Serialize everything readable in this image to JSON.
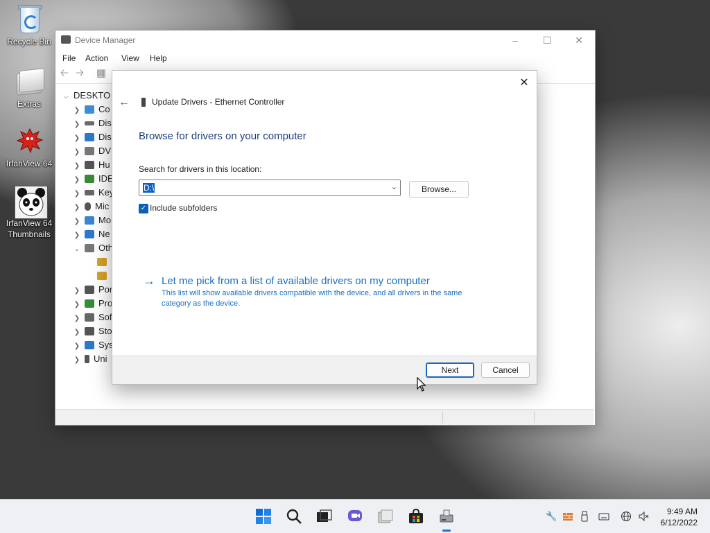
{
  "desktop": {
    "icons": [
      {
        "label": "Recycle Bin"
      },
      {
        "label": "Extras"
      },
      {
        "label": "IrfanView 64"
      },
      {
        "label": "IrfanView 64 Thumbnails"
      }
    ]
  },
  "device_manager": {
    "title": "Device Manager",
    "menu": [
      "File",
      "Action",
      "View",
      "Help"
    ],
    "tree": {
      "root": "DESKTO",
      "items": [
        {
          "label": "Co",
          "color": "#3c8fd6"
        },
        {
          "label": "Dis",
          "color": "#6b6b6b"
        },
        {
          "label": "Dis",
          "color": "#2f77c9"
        },
        {
          "label": "DV",
          "color": "#777777"
        },
        {
          "label": "Hu",
          "color": "#555555"
        },
        {
          "label": "IDE",
          "color": "#3a8a3a"
        },
        {
          "label": "Key",
          "color": "#666666"
        },
        {
          "label": "Mic",
          "color": "#555555"
        },
        {
          "label": "Mo",
          "color": "#3b86d1"
        },
        {
          "label": "Ne",
          "color": "#2f77c9"
        },
        {
          "label": "Oth",
          "color": "#777777"
        },
        {
          "label": "",
          "color": "#d8a227"
        },
        {
          "label": "",
          "color": "#d8a227"
        },
        {
          "label": "Por",
          "color": "#555555"
        },
        {
          "label": "Pro",
          "color": "#3a8a3a"
        },
        {
          "label": "Sof",
          "color": "#666666"
        },
        {
          "label": "Sto",
          "color": "#555555"
        },
        {
          "label": "Sys",
          "color": "#2f77c9"
        },
        {
          "label": "Uni",
          "color": "#555555"
        }
      ]
    }
  },
  "dialog": {
    "header": "Update Drivers - Ethernet Controller",
    "heading": "Browse for drivers on your computer",
    "search_label": "Search for drivers in this location:",
    "path_value": "D:\\",
    "browse_label": "Browse...",
    "include_subfolders_label": "Include subfolders",
    "include_subfolders_checked": true,
    "pick_title": "Let me pick from a list of available drivers on my computer",
    "pick_description": "This list will show available drivers compatible with the device, and all drivers in the same category as the device.",
    "next_label": "Next",
    "cancel_label": "Cancel"
  },
  "taskbar": {
    "time": "9:49 AM",
    "date": "6/12/2022",
    "accent": "#1a73d1"
  }
}
